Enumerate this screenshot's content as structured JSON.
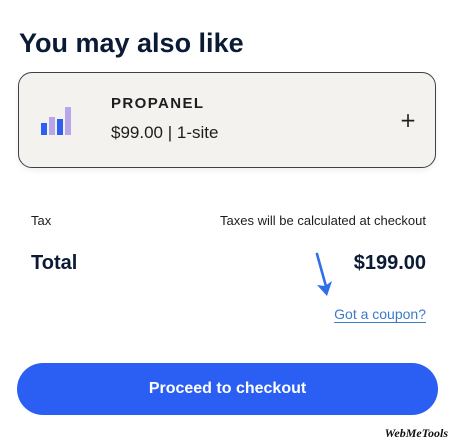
{
  "section": {
    "title": "You may also like"
  },
  "recommendation": {
    "icon": "bar-chart-icon",
    "name": "PROPANEL",
    "price_line": "$99.00 | 1-site",
    "add_label": "+"
  },
  "summary": {
    "tax_label": "Tax",
    "tax_value": "Taxes will be calculated at checkout",
    "total_label": "Total",
    "total_value": "$199.00",
    "coupon_link": "Got a coupon?"
  },
  "checkout": {
    "button_label": "Proceed to checkout"
  },
  "watermark": {
    "text": "WebMeTools"
  },
  "colors": {
    "accent": "#2b5ff3",
    "link": "#3c7ac9",
    "card_background": "#f3f2ee",
    "icon_primary": "#2f5ff0",
    "icon_secondary": "#b7a6ea"
  }
}
